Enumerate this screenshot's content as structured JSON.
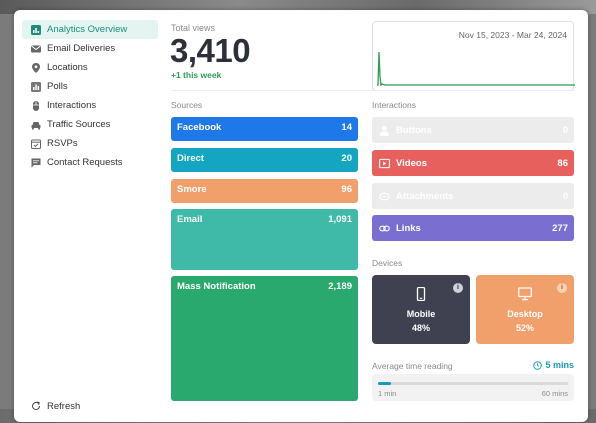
{
  "sidebar": {
    "items": [
      {
        "label": "Analytics Overview",
        "icon": "chart-icon",
        "active": true
      },
      {
        "label": "Email Deliveries",
        "icon": "mail-icon"
      },
      {
        "label": "Locations",
        "icon": "map-pin-icon"
      },
      {
        "label": "Polls",
        "icon": "poll-icon"
      },
      {
        "label": "Interactions",
        "icon": "mouse-icon"
      },
      {
        "label": "Traffic Sources",
        "icon": "car-icon"
      },
      {
        "label": "RSVPs",
        "icon": "calendar-check-icon"
      },
      {
        "label": "Contact Requests",
        "icon": "message-icon"
      }
    ],
    "refresh_label": "Refresh"
  },
  "total_views": {
    "label": "Total views",
    "value": "3,410",
    "week_change": "+1 this week"
  },
  "sparkline": {
    "date_range": "Nov 15, 2023 - Mar 24, 2024",
    "color": "#2a9d56"
  },
  "sources": {
    "label": "Sources",
    "items": [
      {
        "label": "Facebook",
        "value": "14",
        "color": "#1f78e8"
      },
      {
        "label": "Direct",
        "value": "20",
        "color": "#14a5c2"
      },
      {
        "label": "Smore",
        "value": "96",
        "color": "#f2a06b"
      },
      {
        "label": "Email",
        "value": "1,091",
        "color": "#3fbaa8"
      },
      {
        "label": "Mass Notification",
        "value": "2,189",
        "color": "#29a96d"
      }
    ]
  },
  "interactions": {
    "label": "Interactions",
    "items": [
      {
        "label": "Buttons",
        "value": "0",
        "icon": "user-icon",
        "disabled": true,
        "color": "#ececec"
      },
      {
        "label": "Videos",
        "value": "86",
        "icon": "video-icon",
        "disabled": false,
        "color": "#e8605e"
      },
      {
        "label": "Attachments",
        "value": "0",
        "icon": "attachment-icon",
        "disabled": true,
        "color": "#ececec"
      },
      {
        "label": "Links",
        "value": "277",
        "icon": "link-icon",
        "disabled": false,
        "color": "#7a6fd1"
      }
    ]
  },
  "devices": {
    "label": "Devices",
    "mobile": {
      "label": "Mobile",
      "percent": "48%",
      "color": "#3f4150"
    },
    "desktop": {
      "label": "Desktop",
      "percent": "52%",
      "color": "#f2a06b"
    },
    "info_glyph": "i"
  },
  "reading": {
    "label": "Average time reading",
    "value": "5 mins",
    "min_label": "1 min",
    "max_label": "60 mins",
    "fraction": 0.07
  }
}
